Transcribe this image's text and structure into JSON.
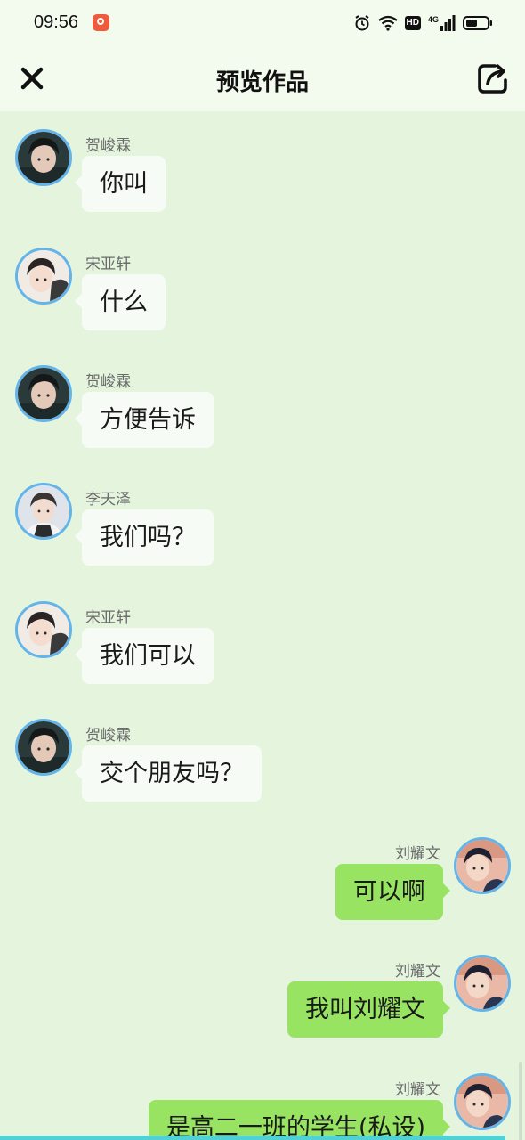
{
  "status_bar": {
    "time": "09:56",
    "network_label": "4G",
    "hd_label": "HD"
  },
  "header": {
    "title": "预览作品"
  },
  "messages": [
    {
      "side": "left",
      "sender": "贺峻霖",
      "text": "你叫",
      "avatar": "avatar-dark"
    },
    {
      "side": "left",
      "sender": "宋亚轩",
      "text": "什么",
      "avatar": "avatar-light"
    },
    {
      "side": "left",
      "sender": "贺峻霖",
      "text": "方便告诉",
      "avatar": "avatar-dark"
    },
    {
      "side": "left",
      "sender": "李天泽",
      "text": "我们吗？",
      "avatar": "avatar-pale"
    },
    {
      "side": "left",
      "sender": "宋亚轩",
      "text": "我们可以",
      "avatar": "avatar-light"
    },
    {
      "side": "left",
      "sender": "贺峻霖",
      "text": "交个朋友吗？",
      "avatar": "avatar-dark"
    },
    {
      "side": "right",
      "sender": "刘耀文",
      "text": "可以啊",
      "avatar": "avatar-warm"
    },
    {
      "side": "right",
      "sender": "刘耀文",
      "text": "我叫刘耀文",
      "avatar": "avatar-warm"
    },
    {
      "side": "right",
      "sender": "刘耀文",
      "text": "是高二一班的学生(私设)",
      "avatar": "avatar-warm"
    }
  ],
  "colors": {
    "background": "#e4f4dd",
    "header_background": "#f3fbef",
    "left_bubble": "#f7fbf5",
    "right_bubble": "#98e462",
    "avatar_ring": "#64b4ea"
  }
}
